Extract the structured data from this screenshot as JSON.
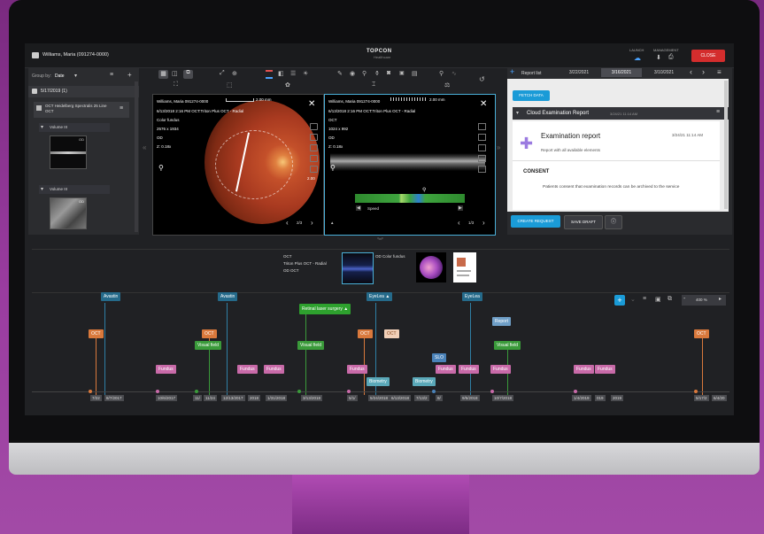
{
  "app": {
    "patient_title": "Williams, Maria (091274-0000)",
    "brand": "TOPCON",
    "brand_sub": "Healthcare",
    "launch_label": "LAUNCH",
    "management_label": "MANAGEMENT",
    "close_label": "CLOSE"
  },
  "sidebar": {
    "group_by_label": "Group by:",
    "group_by_value": "Date",
    "date_group": "5/17/2019 (1)",
    "exam_title": "OCT Heidelberg Spectralis 25 Line OCT",
    "volumes": [
      {
        "label": "Volume III",
        "eye": "OD"
      },
      {
        "label": "Volume III",
        "eye": "OD"
      }
    ]
  },
  "viewer_left": {
    "patient": "Williams, Maria 091274-0000",
    "scale": "2.00 mm",
    "line1": "6/13/2018 2:16 PM OCT:Triton Plus OCT - Radial",
    "line2": "Color fundus",
    "line3": "2576 x 1934",
    "line4": "OD",
    "line5": "Z: 0.18x",
    "page": "2/3"
  },
  "viewer_right": {
    "patient": "Williams, Maria 091274-0000",
    "scale": "2.00 mm",
    "line1": "6/13/2018 2:16 PM OCT:Triton Plus OCT - Radial",
    "line2": "OCT",
    "line3": "1024 x 992",
    "line4": "OD",
    "line5": "Z: 0.18x",
    "speed_label": "Speed",
    "page": "1/3",
    "side_value": "2.00"
  },
  "report": {
    "report_list_label": "Report list",
    "tabs": [
      "3/22/2021",
      "3/16/2021",
      "3/10/2021"
    ],
    "fetch_label": "FETCH DATA",
    "section_title": "Cloud Examination Report",
    "section_date": "3/24/21 11:14 AM",
    "exam_report_title": "Examination report",
    "exam_report_date": "3/24/21 11:14 AM",
    "exam_report_sub": "Report with all available elements",
    "consent_title": "CONSENT",
    "consent_text": "Patients consent that examination records can be archived to the service",
    "create_request_label": "CREATE REQUEST",
    "save_draft_label": "SAVE DRAFT",
    "info_icon": "info-icon"
  },
  "preview": {
    "oct_label_1": "OCT",
    "oct_label_2": "Triton Plus OCT - Radial",
    "oct_label_3": "OD OCT",
    "fundus_label": "OD Color fundus"
  },
  "timeline": {
    "zoom_value": "400 %",
    "top_tags": [
      {
        "label": "Avastin"
      },
      {
        "label": "Avastin"
      },
      {
        "label": "EyeLea"
      },
      {
        "label": "EyeLea"
      }
    ],
    "laser_label": "Retinal laser surgery",
    "oct_tags": [
      "OCT",
      "OCT",
      "OCT",
      "OCT",
      "OCT"
    ],
    "visual_field_tags": [
      "Visual field",
      "Visual field",
      "Visual field"
    ],
    "report_tag": "Report",
    "slo_tag": "SLO",
    "biometry_tags": [
      "Biometry",
      "Biometry"
    ],
    "fundus_tags": [
      "Fundus",
      "Fundus",
      "Fundus",
      "Fundus",
      "Fundus",
      "Fundus",
      "Fundus",
      "Fundus",
      "Fundus",
      "Fundus"
    ],
    "dates": [
      "7/22",
      "8/7/2017",
      "10/6/2017",
      "11/",
      "11/24",
      "12/13/2017",
      "2018",
      "1/31/2018",
      "3/13/2018",
      "5/1/",
      "5/24/2018",
      "6/13/2018",
      "7/13/2",
      "8/",
      "9/5/2018",
      "10/7/2018",
      "1/4/2019",
      "019",
      "2019",
      "5/17/2",
      "6/4/20"
    ]
  }
}
